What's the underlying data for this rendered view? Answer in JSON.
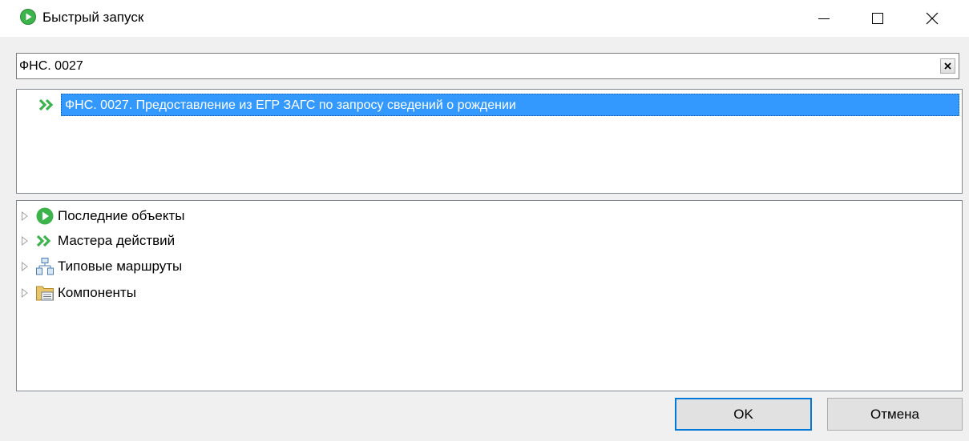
{
  "window": {
    "title": "Быстрый запуск",
    "app_icon": "green-play-circle-icon",
    "controls": [
      "minimize-icon",
      "maximize-icon",
      "close-icon"
    ]
  },
  "search": {
    "value": "ФНС. 0027"
  },
  "results": [
    {
      "icon": "double-chevron-icon",
      "label": "ФНС. 0027. Предоставление из ЕГР ЗАГС по запросу сведений о рождении",
      "selected": true
    }
  ],
  "tree": [
    {
      "icon": "green-play-circle-icon",
      "label": "Последние объекты"
    },
    {
      "icon": "double-chevron-icon",
      "label": "Мастера действий"
    },
    {
      "icon": "route-hierarchy-icon",
      "label": "Типовые маршруты"
    },
    {
      "icon": "folder-icon",
      "label": "Компоненты"
    }
  ],
  "buttons": {
    "ok": "OK",
    "cancel": "Отмена"
  },
  "colors": {
    "accent": "#0078d7",
    "selection": "#3399ff",
    "green": "#3cb44b"
  }
}
